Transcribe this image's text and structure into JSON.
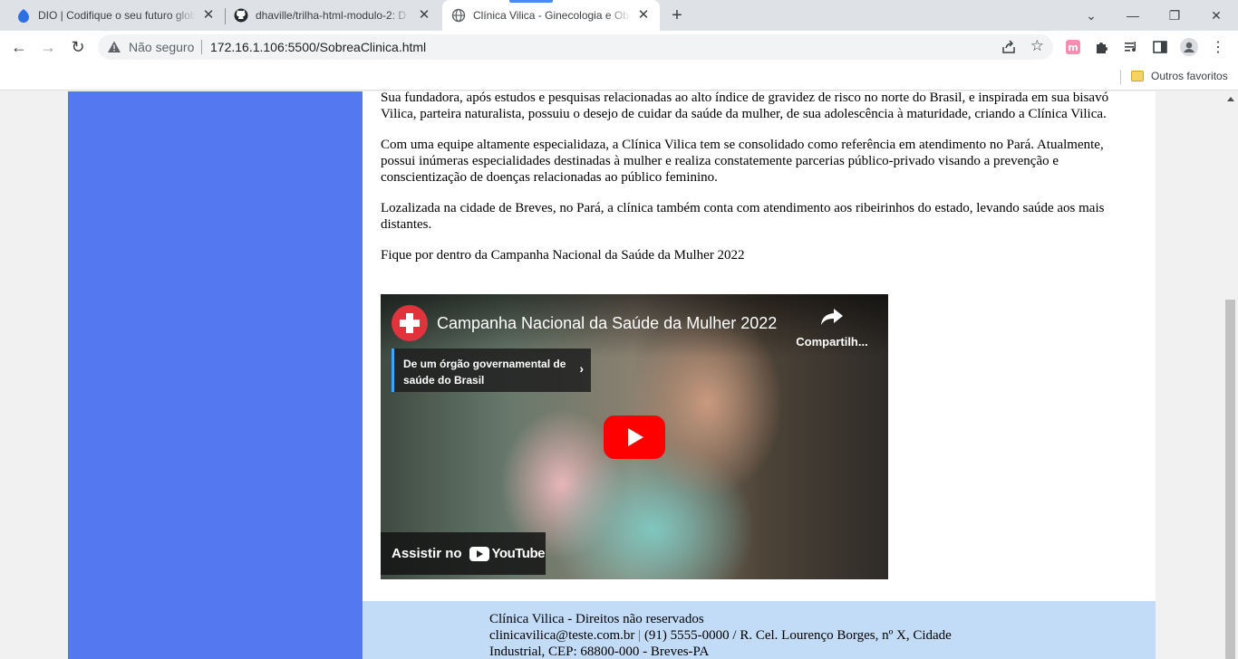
{
  "browser": {
    "tabs": [
      {
        "title": "DIO | Codifique o seu futuro glob",
        "icon": "dio-icon"
      },
      {
        "title": "dhaville/trilha-html-modulo-2: D",
        "icon": "github-icon"
      },
      {
        "title": "Clínica Vilica - Ginecologia e Obs",
        "icon": "globe-icon",
        "active": true
      }
    ],
    "security_label": "Não seguro",
    "url": "172.16.1.106:5500/SobreaClinica.html",
    "bookmarks_folder": "Outros favoritos",
    "colors": {
      "tabstrip": "#dee1e6",
      "active_tab": "#ffffff",
      "tab_indicator": "#4c8bf5"
    }
  },
  "page": {
    "paragraphs": [
      "Sua fundadora, após estudos e pesquisas relacionadas ao alto índice de gravidez de risco no norte do Brasil, e inspirada em sua bisavó Vilica, parteira naturalista, possuiu o desejo de cuidar da saúde da mulher, de sua adolescência à maturidade, criando a Clínica Vilica.",
      "Com uma equipe altamente especialidaza, a Clínica Vilica tem se consolidado como referência em atendimento no Pará. Atualmente, possui inúmeras especialidades destinadas à mulher e realiza constatemente parcerias público-privado visando a prevenção e conscientização de doenças relacionadas ao público feminino.",
      "Lozalizada na cidade de Breves, no Pará, a clínica também conta com atendimento aos ribeirinhos do estado, levando saúde aos mais distantes.",
      "Fique por dentro da Campanha Nacional da Saúde da Mulher 2022"
    ],
    "video": {
      "title": "Campanha Nacional da Saúde da Mulher 2022",
      "share_label": "Compartilh...",
      "info_panel": "De um órgão governamental de saúde do Brasil",
      "watch_on": "Assistir no",
      "platform": "YouTube"
    },
    "footer": {
      "line1": "Clínica Vilica - Direitos não reservados",
      "email": "clinicavilica@teste.com.br",
      "separator": "|",
      "contact": "(91) 5555-0000 / R. Cel. Lourenço Borges, nº X, Cidade Industrial, CEP: 68800-000 - Breves-PA"
    },
    "colors": {
      "sidebar": "#5478f0",
      "main": "#ffffff",
      "footer": "#c2dcf7",
      "page_bg": "#f1f1f1"
    }
  }
}
